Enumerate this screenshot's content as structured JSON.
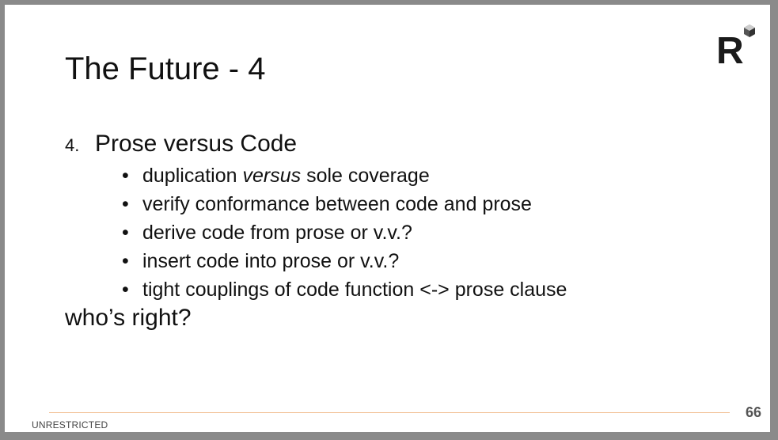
{
  "slide": {
    "title": "The Future - 4",
    "logo_letter": "R",
    "item_number": "4.",
    "item_text": "Prose versus Code",
    "bullets": [
      {
        "before": "duplication ",
        "em": "versus",
        "after": " sole coverage"
      },
      {
        "before": "verify conformance between code and prose",
        "em": "",
        "after": ""
      },
      {
        "before": "derive code from prose or v.v.?",
        "em": "",
        "after": ""
      },
      {
        "before": "insert code into prose or v.v.?",
        "em": "",
        "after": ""
      },
      {
        "before": "tight couplings of code function <-> prose clause",
        "em": "",
        "after": ""
      }
    ],
    "bullet_glyph": "•",
    "closing": "who’s right?",
    "footer_label": "UNRESTRICTED",
    "page_number": "66"
  },
  "colors": {
    "frame": "#8a8a8a",
    "background": "#ffffff",
    "text": "#111111",
    "footer_rule": "#f0b98a",
    "logo": "#1a1a1a"
  },
  "icons": {
    "logo": "r-logo-icon"
  }
}
